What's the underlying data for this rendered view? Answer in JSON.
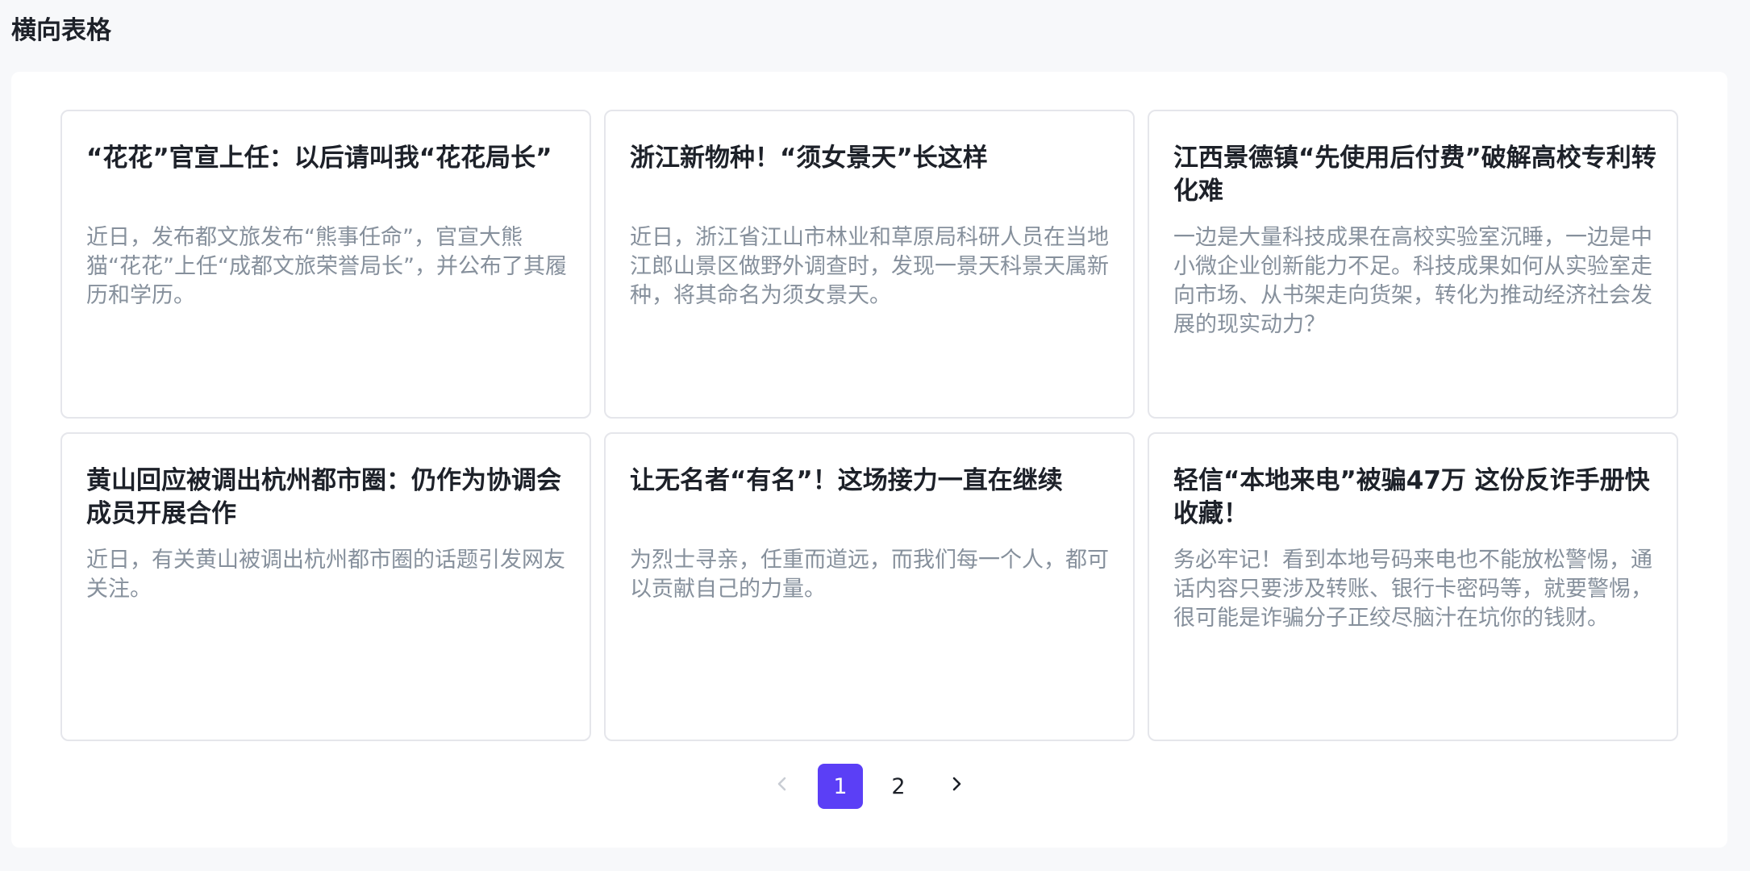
{
  "header": {
    "title": "横向表格"
  },
  "cards": [
    {
      "title": "“花花”官宣上任：以后请叫我“花花局长”",
      "summary": "近日，发布都文旅发布“熊事任命”，官宣大熊猫“花花”上任“成都文旅荣誉局长”，并公布了其履历和学历。"
    },
    {
      "title": "浙江新物种！“须女景天”长这样",
      "summary": "近日，浙江省江山市林业和草原局科研人员在当地江郎山景区做野外调查时，发现一景天科景天属新种，将其命名为须女景天。"
    },
    {
      "title": "江西景德镇“先使用后付费”破解高校专利转化难",
      "summary": "一边是大量科技成果在高校实验室沉睡，一边是中小微企业创新能力不足。科技成果如何从实验室走向市场、从书架走向货架，转化为推动经济社会发展的现实动力？"
    },
    {
      "title": "黄山回应被调出杭州都市圈：仍作为协调会成员开展合作",
      "summary": "近日，有关黄山被调出杭州都市圈的话题引发网友关注。"
    },
    {
      "title": "让无名者“有名”！这场接力一直在继续",
      "summary": "为烈士寻亲，任重而道远，而我们每一个人，都可以贡献自己的力量。"
    },
    {
      "title": "轻信“本地来电”被骗47万 这份反诈手册快收藏！",
      "summary": "务必牢记！看到本地号码来电也不能放松警惕，通话内容只要涉及转账、银行卡密码等，就要警惕，很可能是诈骗分子正绞尽脑汁在坑你的钱财。"
    }
  ],
  "pagination": {
    "prev_icon": "chevron-left-icon",
    "next_icon": "chevron-right-icon",
    "pages": [
      "1",
      "2"
    ],
    "current": "1",
    "active_color": "#5b3ff6"
  }
}
